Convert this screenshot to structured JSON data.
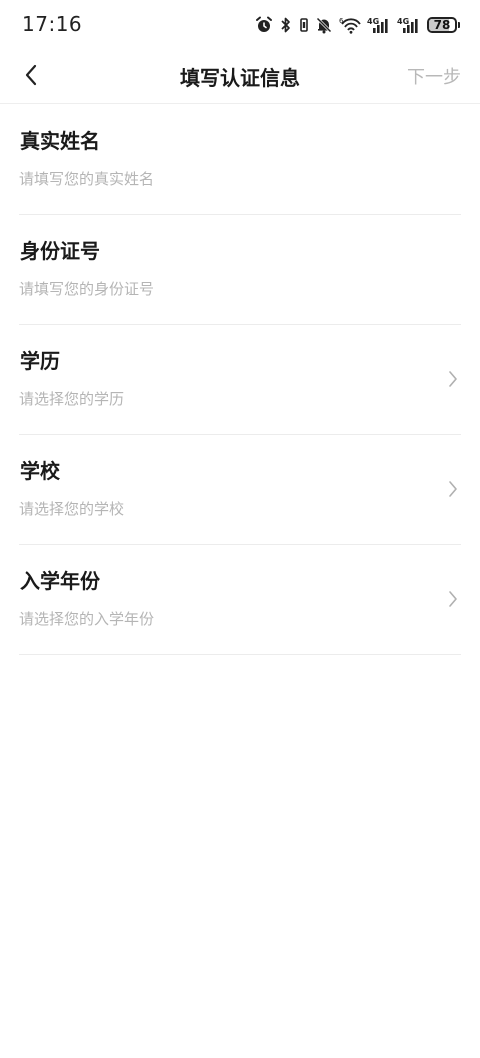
{
  "status_bar": {
    "time": "17:16",
    "battery_level": "78",
    "battery_fraction": 0.78,
    "icons": [
      "alarm-icon",
      "bluetooth-icon",
      "mute-icon",
      "wifi-icon",
      "signal-4g-icon",
      "signal-4g-icon",
      "battery-icon"
    ],
    "net_label_1": "4G",
    "net_label_2": "4G",
    "wifi_label": "6"
  },
  "nav": {
    "back_icon": "chevron-left-icon",
    "title": "填写认证信息",
    "next_label": "下一步"
  },
  "form": {
    "name": {
      "label": "真实姓名",
      "placeholder": "请填写您的真实姓名",
      "value": ""
    },
    "id_number": {
      "label": "身份证号",
      "placeholder": "请填写您的身份证号",
      "value": ""
    },
    "education": {
      "label": "学历",
      "placeholder": "请选择您的学历",
      "icon": "chevron-right-icon"
    },
    "school": {
      "label": "学校",
      "placeholder": "请选择您的学校",
      "icon": "chevron-right-icon"
    },
    "enroll_year": {
      "label": "入学年份",
      "placeholder": "请选择您的入学年份",
      "icon": "chevron-right-icon"
    }
  },
  "colors": {
    "title_text": "#1a1a1a",
    "placeholder": "#b5b5b5",
    "disabled_action": "#b8b8b8",
    "divider": "#ececec",
    "background": "#ffffff"
  }
}
